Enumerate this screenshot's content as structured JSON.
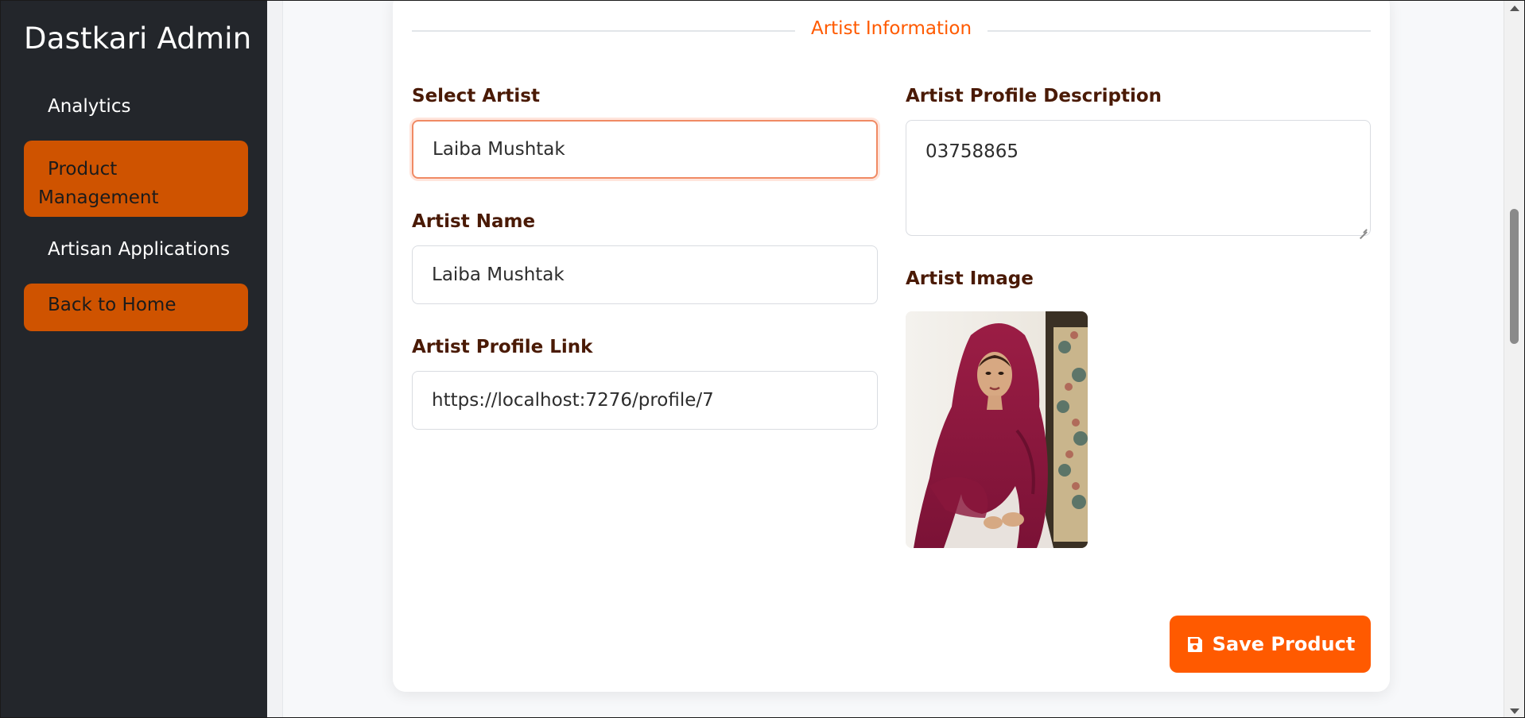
{
  "sidebar": {
    "brand": "Dastkari Admin",
    "items": [
      {
        "label": "Analytics"
      },
      {
        "label_line1": "Product",
        "label_line2": "Management"
      },
      {
        "label": "Artisan Applications"
      },
      {
        "label": "Back to Home"
      }
    ]
  },
  "section": {
    "title": "Artist Information"
  },
  "form": {
    "select_artist": {
      "label": "Select Artist",
      "value": "Laiba Mushtak"
    },
    "artist_name": {
      "label": "Artist Name",
      "value": "Laiba Mushtak"
    },
    "artist_profile_link": {
      "label": "Artist Profile Link",
      "value": "https://localhost:7276/profile/7"
    },
    "artist_profile_description": {
      "label": "Artist Profile Description",
      "value": "03758865"
    },
    "artist_image": {
      "label": "Artist Image"
    }
  },
  "actions": {
    "save_label": "Save Product",
    "save_icon": "floppy-disk-icon"
  },
  "colors": {
    "accent": "#ff5a00",
    "sidebar_active": "#cf5300",
    "sidebar_bg": "#23262b",
    "label_text": "#4a1a05"
  }
}
